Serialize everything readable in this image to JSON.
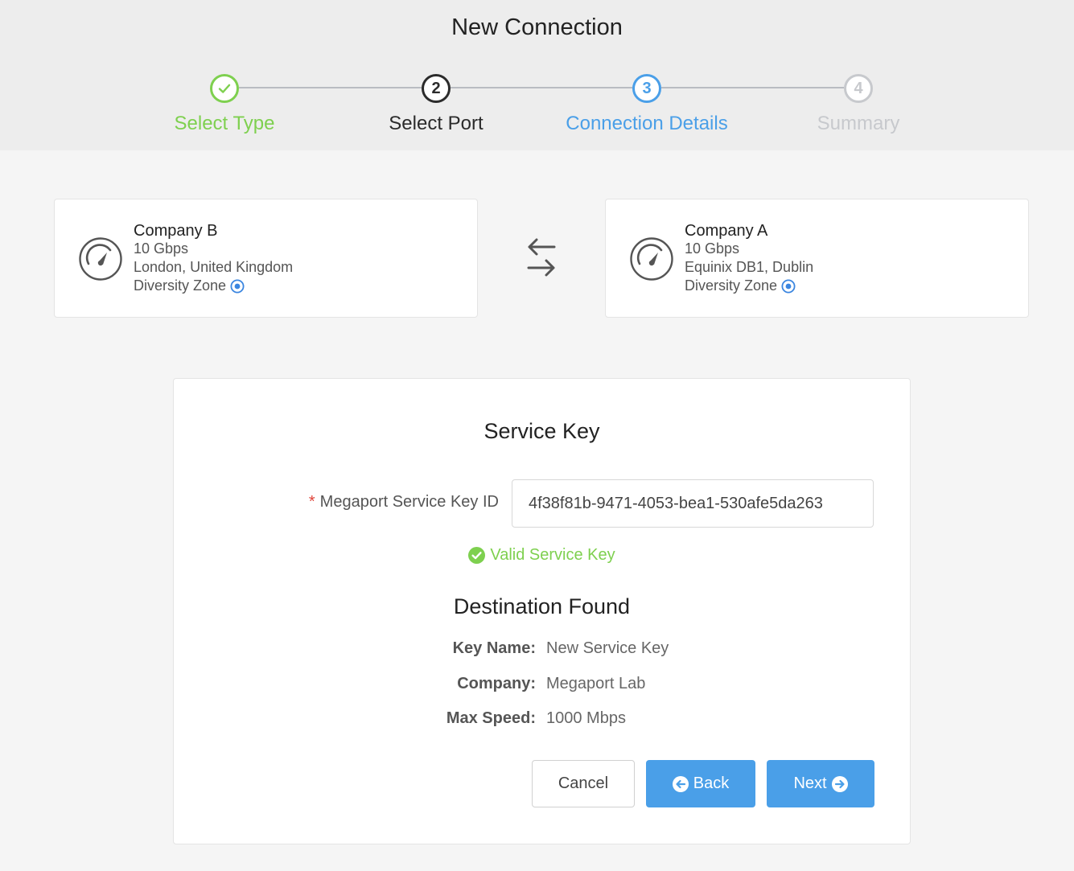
{
  "header": {
    "title": "New Connection"
  },
  "steps": [
    {
      "label": "Select Type",
      "number": "1",
      "state": "done"
    },
    {
      "label": "Select Port",
      "number": "2",
      "state": "current"
    },
    {
      "label": "Connection Details",
      "number": "3",
      "state": "active"
    },
    {
      "label": "Summary",
      "number": "4",
      "state": "todo"
    }
  ],
  "ports": {
    "left": {
      "name": "Company B",
      "speed": "10 Gbps",
      "location": "London, United Kingdom",
      "zone": "Diversity Zone"
    },
    "right": {
      "name": "Company A",
      "speed": "10 Gbps",
      "location": "Equinix DB1, Dublin",
      "zone": "Diversity Zone"
    }
  },
  "service_key": {
    "title": "Service Key",
    "required_mark": "*",
    "field_label": "Megaport Service Key ID",
    "value": "4f38f81b-9471-4053-bea1-530afe5da263",
    "valid_text": "Valid Service Key"
  },
  "destination": {
    "title": "Destination Found",
    "key_name_label": "Key Name:",
    "key_name": "New Service Key",
    "company_label": "Company:",
    "company": "Megaport Lab",
    "max_speed_label": "Max Speed:",
    "max_speed": "1000 Mbps"
  },
  "buttons": {
    "cancel": "Cancel",
    "back": "Back",
    "next": "Next"
  },
  "colors": {
    "success": "#7ed04f",
    "primary": "#4a9fe8",
    "required": "#e0443a",
    "inactive": "#c7c9cd"
  }
}
